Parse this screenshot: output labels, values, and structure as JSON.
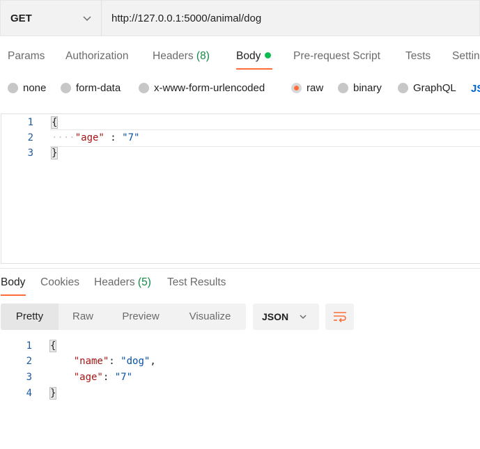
{
  "url_bar": {
    "method": "GET",
    "url": "http://127.0.0.1:5000/animal/dog"
  },
  "request_tabs": [
    {
      "label": "Params"
    },
    {
      "label": "Authorization"
    },
    {
      "label": "Headers",
      "count": "(8)"
    },
    {
      "label": "Body",
      "active": true
    },
    {
      "label": "Pre-request Script"
    },
    {
      "label": "Tests"
    },
    {
      "label": "Settin"
    }
  ],
  "body_types": {
    "options": [
      "none",
      "form-data",
      "x-www-form-urlencoded",
      "raw",
      "binary",
      "GraphQL"
    ],
    "selected": "raw",
    "language_link": "JS"
  },
  "request_editor": {
    "lines": [
      {
        "number": "1",
        "text": "{"
      },
      {
        "number": "2",
        "key": "\"age\"",
        "sep": " : ",
        "value": "\"7\""
      },
      {
        "number": "3",
        "text": "}"
      }
    ]
  },
  "response_tabs": [
    {
      "label": "Body",
      "active": true
    },
    {
      "label": "Cookies"
    },
    {
      "label": "Headers",
      "count": "(5)"
    },
    {
      "label": "Test Results"
    }
  ],
  "response_toolbar": {
    "formats": [
      "Pretty",
      "Raw",
      "Preview",
      "Visualize"
    ],
    "selected_format": "Pretty",
    "language": "JSON"
  },
  "response_body": {
    "lines": [
      {
        "number": "1",
        "text": "{"
      },
      {
        "number": "2",
        "key": "\"name\"",
        "sep": ": ",
        "value": "\"dog\"",
        "trail": ","
      },
      {
        "number": "3",
        "key": "\"age\"",
        "sep": ": ",
        "value": "\"7\""
      },
      {
        "number": "4",
        "text": "}"
      }
    ]
  },
  "colors": {
    "accent": "#ff6c37",
    "body_dot": "#0cbb52",
    "count_green": "#0f8a44",
    "line_number": "#1d5aa0",
    "json_key": "#a31515",
    "json_value": "#0451a5",
    "link_blue": "#0265d2"
  }
}
